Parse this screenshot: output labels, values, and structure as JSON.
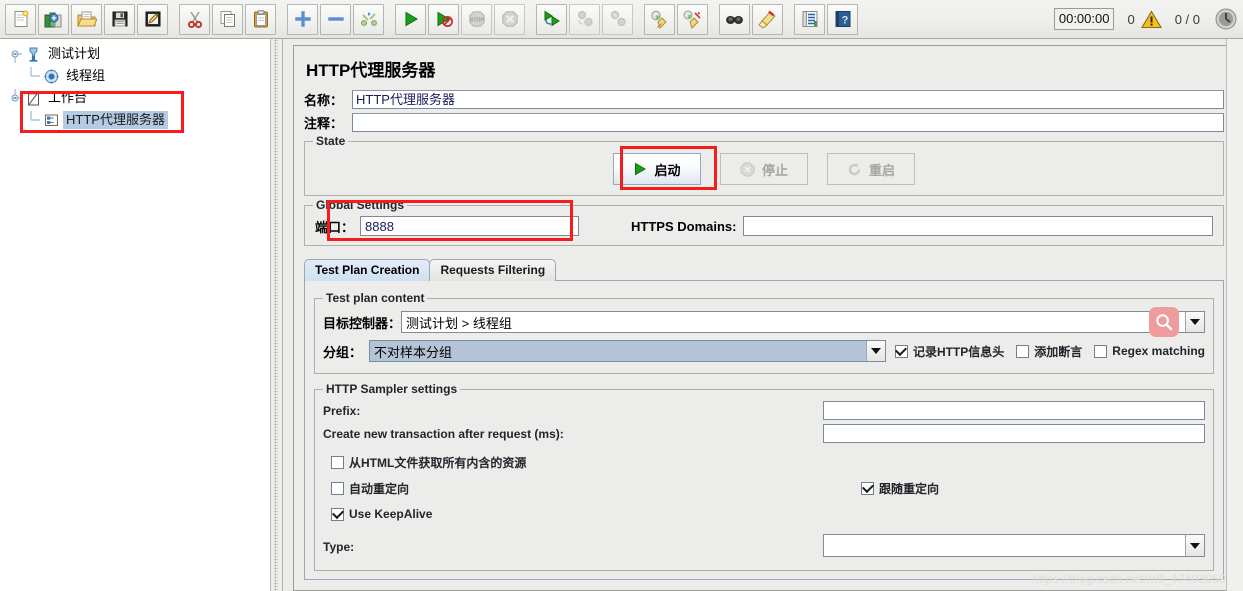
{
  "toolbar": {
    "buttons": [
      {
        "name": "new-icon",
        "title": "New"
      },
      {
        "name": "templates-icon",
        "title": "Templates"
      },
      {
        "name": "open-icon",
        "title": "Open"
      },
      {
        "name": "save-icon",
        "title": "Save"
      },
      {
        "name": "save-as-icon",
        "title": "Save As"
      },
      {
        "name": "cut-icon",
        "title": "Cut"
      },
      {
        "name": "copy-icon",
        "title": "Copy"
      },
      {
        "name": "paste-icon",
        "title": "Paste"
      },
      {
        "name": "expand-all-icon",
        "title": "Expand All"
      },
      {
        "name": "collapse-all-icon",
        "title": "Collapse All"
      },
      {
        "name": "toggle-icon",
        "title": "Toggle"
      },
      {
        "name": "start-icon",
        "title": "Start"
      },
      {
        "name": "start-no-pauses-icon",
        "title": "Start no pauses"
      },
      {
        "name": "stop-icon",
        "title": "Stop"
      },
      {
        "name": "shutdown-icon",
        "title": "Shutdown"
      },
      {
        "name": "start-remote-all-icon",
        "title": "Start remote all"
      },
      {
        "name": "stop-remote-all-icon",
        "title": "Stop remote all"
      },
      {
        "name": "shutdown-remote-all-icon",
        "title": "Shutdown remote all"
      },
      {
        "name": "clear-icon",
        "title": "Clear"
      },
      {
        "name": "clear-all-icon",
        "title": "Clear All"
      },
      {
        "name": "search-icon",
        "title": "Search"
      },
      {
        "name": "reset-search-icon",
        "title": "Reset Search"
      },
      {
        "name": "function-helper-icon",
        "title": "Function Helper Dialog"
      },
      {
        "name": "help-icon",
        "title": "Help"
      }
    ],
    "status": {
      "timer": "00:00:00",
      "warning_count": "0",
      "thread_counts": "0 / 0"
    }
  },
  "tree": {
    "items": [
      {
        "label": "测试计划",
        "icon": "test-plan-icon",
        "depth": 0,
        "selected": false
      },
      {
        "label": "线程组",
        "icon": "thread-group-icon",
        "depth": 1,
        "selected": false
      },
      {
        "label": "工作台",
        "icon": "workbench-icon",
        "depth": 0,
        "selected": false
      },
      {
        "label": "HTTP代理服务器",
        "icon": "http-proxy-server-icon",
        "depth": 1,
        "selected": true
      }
    ]
  },
  "panel": {
    "title": "HTTP代理服务器",
    "name_label": "名称：",
    "name_value": "HTTP代理服务器",
    "comment_label": "注释：",
    "comment_value": "",
    "state": {
      "legend": "State",
      "start_label": "启动",
      "stop_label": "停止",
      "restart_label": "重启"
    },
    "global_settings": {
      "legend": "Global Settings",
      "port_label": "端口：",
      "port_value": "8888",
      "https_domains_label": "HTTPS Domains:",
      "https_domains_value": ""
    },
    "tabs": [
      {
        "label": "Test Plan Creation",
        "active": true
      },
      {
        "label": "Requests Filtering",
        "active": false
      }
    ],
    "test_plan_content": {
      "legend": "Test plan content",
      "target_controller_label": "目标控制器：",
      "target_controller_value": "测试计划 > 线程组",
      "grouping_label": "分组：",
      "grouping_value": "不对样本分组",
      "options": [
        {
          "label": "记录HTTP信息头",
          "checked": true
        },
        {
          "label": "添加断言",
          "checked": false
        },
        {
          "label": "Regex matching",
          "checked": false
        }
      ]
    },
    "sampler_settings": {
      "legend": "HTTP Sampler settings",
      "prefix_label": "Prefix:",
      "prefix_value": "",
      "transaction_label": "Create new transaction after request (ms):",
      "transaction_value": "",
      "retrieve_resources": {
        "label": "从HTML文件获取所有内含的资源",
        "checked": false
      },
      "auto_redirect": {
        "label": "自动重定向",
        "checked": false
      },
      "follow_redirect": {
        "label": "跟随重定向",
        "checked": true
      },
      "keepalive": {
        "label": "Use KeepAlive",
        "checked": true
      },
      "type_label": "Type:",
      "type_value": ""
    }
  },
  "watermark": "https://blog.csdn.net/m0_47403059",
  "colors": {
    "highlight_red": "#f41c1c",
    "selection_blue": "#b5cbe3",
    "panel_gray": "#ececea",
    "search_chip_pink": "#ef9c9c"
  }
}
